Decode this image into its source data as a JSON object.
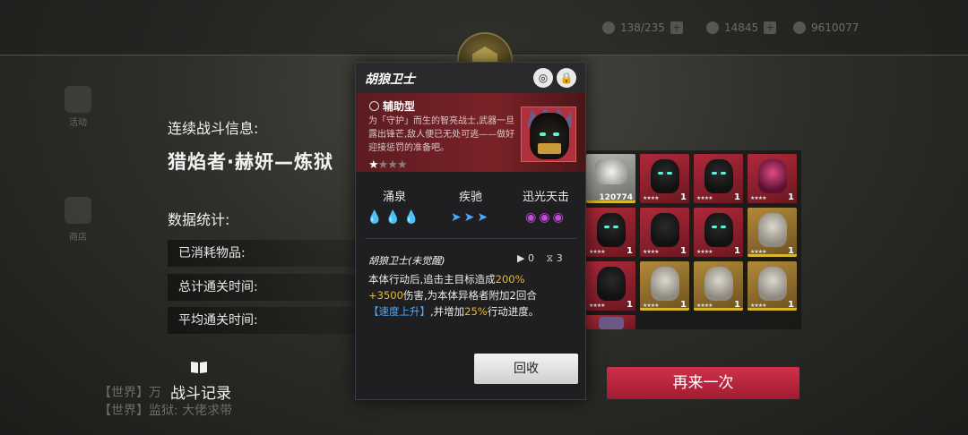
{
  "topbar": {
    "resources": [
      {
        "value": "138/235",
        "icon": "energy-icon"
      },
      {
        "value": "14845",
        "icon": "gem-icon"
      },
      {
        "value": "9610077",
        "icon": "coin-icon"
      }
    ],
    "plus": "+"
  },
  "left_nav": {
    "items": [
      {
        "label": "活动"
      },
      {
        "label": "商店"
      }
    ]
  },
  "info": {
    "battle_title": "连续战斗信息:",
    "char_name": "猎焰者·赫妍—炼狱",
    "stats_title": "数据统计:",
    "stats": [
      {
        "label": "已消耗物品:"
      },
      {
        "label": "总计通关时间:"
      },
      {
        "label": "平均通关时间:"
      }
    ],
    "log_label": "战斗记录",
    "log_icon": "book-icon"
  },
  "chat": {
    "line1": "【世界】万",
    "line2": "【世界】监狱: 大佬求带"
  },
  "grid": {
    "retry_label": "再来一次",
    "items": [
      {
        "type": "silver",
        "count": "120774",
        "icon": "silver-ore-icon"
      },
      {
        "type": "red",
        "count": "1",
        "rarity": "★★★★",
        "icon": "jackal-guard-icon"
      },
      {
        "type": "red",
        "count": "1",
        "rarity": "★★★★",
        "icon": "jackal-guard-icon"
      },
      {
        "type": "red",
        "count": "1",
        "rarity": "★★★★",
        "icon": "crimson-knight-icon"
      },
      {
        "type": "gold",
        "count": "1",
        "rarity": "★★★★",
        "icon": "masked-beast-icon"
      },
      {
        "type": "red",
        "count": "1",
        "rarity": "★★★★",
        "icon": "jackal-guard-icon"
      },
      {
        "type": "red",
        "count": "1",
        "rarity": "★★★★",
        "icon": "top-hat-mage-icon"
      },
      {
        "type": "red",
        "count": "1",
        "rarity": "★★★★",
        "icon": "jackal-guard-icon"
      },
      {
        "type": "gold",
        "count": "1",
        "rarity": "★★★★",
        "icon": "masked-beast-icon"
      },
      {
        "type": "red",
        "count": "1",
        "rarity": "★★★★",
        "icon": "top-hat-mage-icon"
      },
      {
        "type": "gold",
        "count": "1",
        "rarity": "★★★★",
        "icon": "masked-beast-icon"
      },
      {
        "type": "gold",
        "count": "1",
        "rarity": "★★★★",
        "icon": "masked-beast-icon"
      },
      {
        "type": "gold",
        "count": "1",
        "rarity": "★★★★",
        "icon": "masked-beast-icon"
      },
      {
        "type": "red",
        "count": "",
        "rarity": "",
        "icon": "jackal-guard-icon"
      }
    ]
  },
  "card": {
    "title": "胡狼卫士",
    "type_label": "辅助型",
    "description": "为「守护」而生的智亮战士,武器一旦露出锋芒,敌人便已无处可逃——做好迎接惩罚的准备吧。",
    "stars_filled": 1,
    "stars_total": 4,
    "star_on": "★",
    "star_off": "★★★",
    "traits": [
      {
        "label": "涌泉",
        "icons": "💧💧💧",
        "color": "#b9e04a"
      },
      {
        "label": "疾驰",
        "icons": "➤➤➤",
        "color": "#4aa8ff"
      },
      {
        "label": "迅光天击",
        "icons": "◉◉◉",
        "color": "#c24ae0"
      }
    ],
    "skill": {
      "name": "胡狼卫士(未觉醒)",
      "uses": "0",
      "cooldown": "3",
      "desc_1": "本体行动后,追击主目标造成",
      "pct": "200%",
      "flat": "+3500",
      "desc_2": "伤害,为本体异格者附加2回合",
      "buff": "【速度上升】",
      "desc_3": ",并增加",
      "speed": "25%",
      "desc_4": "行动进度。"
    },
    "recycle_label": "回收"
  }
}
